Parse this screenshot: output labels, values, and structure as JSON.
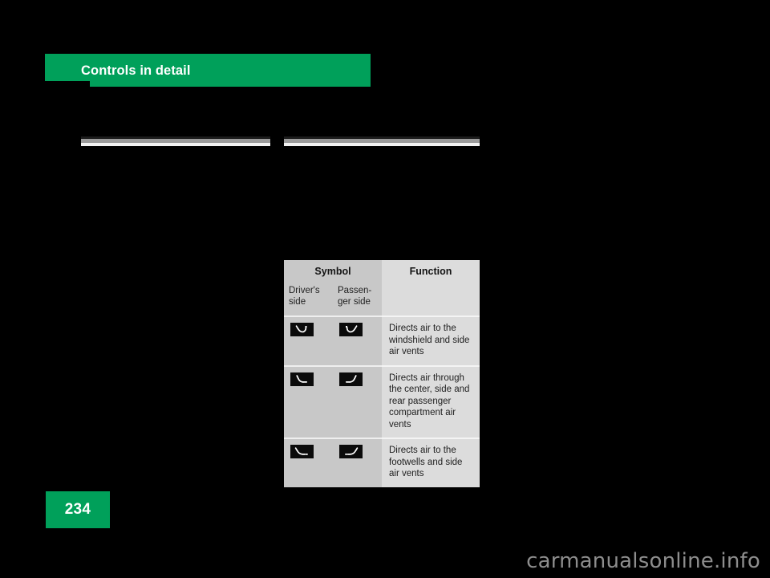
{
  "page": {
    "section_title": "Controls in detail",
    "page_number": "234",
    "watermark": "carmanualsonline.info",
    "accent_color": "#00A05A",
    "background_color": "#000000"
  },
  "rules": {
    "left_rule_name": "left-column-rule",
    "right_rule_name": "right-column-rule"
  },
  "table": {
    "header": {
      "symbol_title": "Symbol",
      "function_title": "Function",
      "driver_side_label": "Driver's side",
      "passenger_side_label": "Passen- ger side"
    },
    "rows": [
      {
        "driver_icon": "airflow-defrost-icon",
        "passenger_icon": "airflow-defrost-icon",
        "function": "Directs air to the windshield and side air vents"
      },
      {
        "driver_icon": "airflow-center-vents-icon",
        "passenger_icon": "airflow-center-vents-icon",
        "function": "Directs air through the center, side and rear passenger compartment air vents"
      },
      {
        "driver_icon": "airflow-footwell-icon",
        "passenger_icon": "airflow-footwell-icon",
        "function": "Directs air to the footwells and side air vents"
      }
    ]
  }
}
